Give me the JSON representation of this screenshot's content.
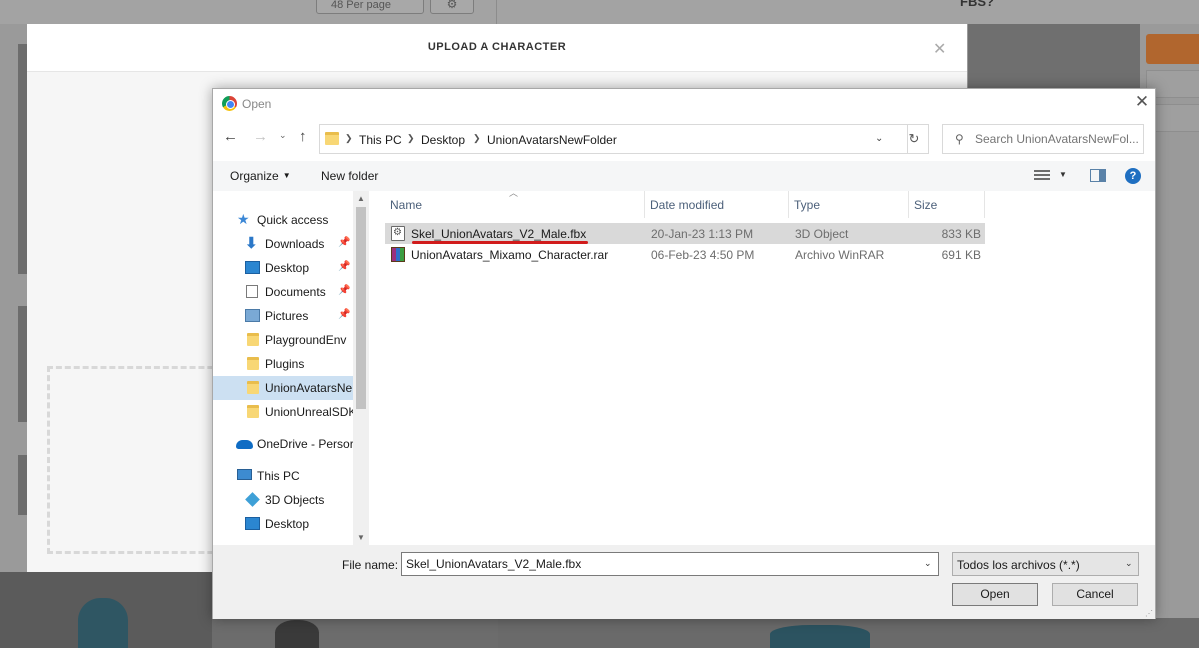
{
  "background": {
    "per_page_label": "48 Per page",
    "code_text": "FBS?",
    "upload_modal": {
      "title": "UPLOAD A CHARACTER",
      "close_glyph": "✕"
    }
  },
  "dialog": {
    "title": "Open",
    "close_glyph": "✕",
    "address": {
      "crumbs": [
        "This PC",
        "Desktop",
        "UnionAvatarsNewFolder"
      ]
    },
    "search": {
      "placeholder": "Search UnionAvatarsNewFol..."
    },
    "toolbar": {
      "organize": "Organize",
      "new_folder": "New folder"
    },
    "nav_pane": {
      "items": [
        {
          "label": "Quick access",
          "icon": "star-icon"
        },
        {
          "label": "Downloads",
          "icon": "download-icon",
          "pinned": true
        },
        {
          "label": "Desktop",
          "icon": "desktop-icon",
          "pinned": true
        },
        {
          "label": "Documents",
          "icon": "documents-icon",
          "pinned": true
        },
        {
          "label": "Pictures",
          "icon": "pictures-icon",
          "pinned": true
        },
        {
          "label": "PlaygroundEnv",
          "icon": "folder-icon"
        },
        {
          "label": "Plugins",
          "icon": "folder-icon"
        },
        {
          "label": "UnionAvatarsNe",
          "icon": "folder-icon",
          "selected": true
        },
        {
          "label": "UnionUnrealSDK",
          "icon": "folder-icon"
        },
        {
          "label": "OneDrive - Persor",
          "icon": "onedrive-icon"
        },
        {
          "label": "This PC",
          "icon": "this-pc-icon"
        },
        {
          "label": "3D Objects",
          "icon": "3d-objects-icon"
        },
        {
          "label": "Desktop",
          "icon": "desktop-icon"
        }
      ]
    },
    "columns": [
      "Name",
      "Date modified",
      "Type",
      "Size"
    ],
    "files": [
      {
        "name": "Skel_UnionAvatars_V2_Male.fbx",
        "date": "20-Jan-23 1:13 PM",
        "type": "3D Object",
        "size": "833 KB",
        "icon": "fbx-file-icon",
        "selected": true
      },
      {
        "name": "UnionAvatars_Mixamo_Character.rar",
        "date": "06-Feb-23 4:50 PM",
        "type": "Archivo WinRAR",
        "size": "691 KB",
        "icon": "winrar-file-icon",
        "selected": false
      }
    ],
    "file_name_label": "File name:",
    "file_name_value": "Skel_UnionAvatars_V2_Male.fbx",
    "file_type_value": "Todos los archivos (*.*)",
    "open_button": "Open",
    "cancel_button": "Cancel"
  },
  "colors": {
    "accent": "#1f6fc1",
    "selection": "#cce0f2",
    "annotation_underline": "#d11c1c",
    "orange_button": "#b1662e"
  }
}
